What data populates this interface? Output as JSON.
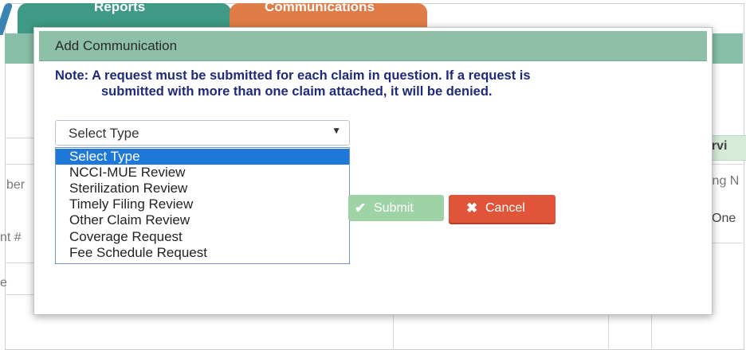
{
  "background": {
    "tabs": {
      "reports": "Reports",
      "communications": "Communications"
    },
    "fragments": {
      "ber": "ber",
      "acct": "nt #",
      "e": "e",
      "servi": "ervi",
      "ing": "ing N",
      "one": "One"
    }
  },
  "modal": {
    "title": "Add Communication",
    "note_line1": "Note: A request must be submitted for each claim in question. If a request is",
    "note_line2": "submitted with more than one claim attached, it will be denied.",
    "select": {
      "value": "Select Type",
      "options": [
        "Select Type",
        "NCCI-MUE Review",
        "Sterilization Review",
        "Timely Filing Review",
        "Other Claim Review",
        "Coverage Request",
        "Fee Schedule Request"
      ]
    },
    "buttons": {
      "submit": "Submit",
      "cancel": "Cancel"
    }
  },
  "colors": {
    "header": "#8ebfa8",
    "note_text": "#1e2a7a",
    "option_selected": "#1e78d7",
    "submit": "#9ed3a6",
    "cancel": "#e0553a",
    "tab_reports": "#3e9a84",
    "tab_communications": "#e07c47"
  },
  "icons": {
    "submit": "check-icon",
    "cancel": "close-icon",
    "select": "triangle-down-icon"
  }
}
